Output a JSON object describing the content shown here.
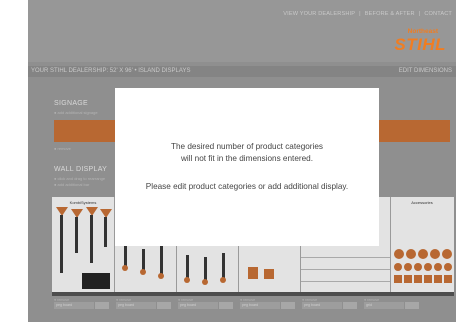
{
  "nav": {
    "view_dealership": "VIEW YOUR DEALERSHIP",
    "before_after": "BEFORE & AFTER",
    "contact": "CONTACT",
    "separator": "|"
  },
  "logo": {
    "top_text": "Northeast",
    "main_text": "STIHL",
    "color": "#f07d22"
  },
  "title_bar": {
    "left": "YOUR STIHL DEALERSHIP: 52' X 96' • ISLAND DISPLAYS",
    "right": "EDIT DIMENSIONS"
  },
  "signage": {
    "title": "SIGNAGE",
    "add_link": "● add additional signage",
    "remove": "● remove"
  },
  "wall_display": {
    "title": "WALL DISPLAY",
    "sub1": "● click and drag to rearrange",
    "sub2": "● add additional bar",
    "columns": [
      "KombiSystems",
      "",
      "",
      "",
      "",
      "Accessories"
    ]
  },
  "controls": [
    {
      "remove": "● remove",
      "select": "peg board"
    },
    {
      "remove": "● remove",
      "select": "peg board"
    },
    {
      "remove": "● remove",
      "select": "peg board"
    },
    {
      "remove": "● remove",
      "select": "peg board"
    },
    {
      "remove": "● remove",
      "select": "peg board"
    },
    {
      "remove": "● remove",
      "select": "grid"
    }
  ],
  "modal": {
    "line1": "The desired number of product categories",
    "line2": "will not fit in the dimensions entered.",
    "line3": "Please edit product categories or add additional display."
  },
  "colors": {
    "accent": "#b86832",
    "background": "#8f8f8f",
    "modal": "#ffffff"
  }
}
